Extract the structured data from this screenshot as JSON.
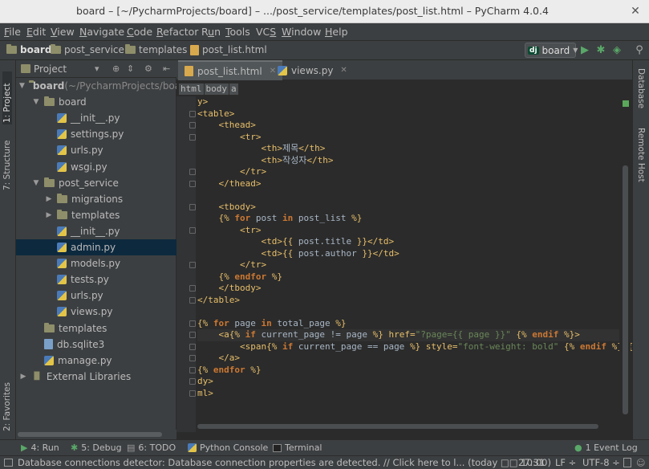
{
  "window": {
    "title": "board – [~/PycharmProjects/board] – .../post_service/templates/post_list.html – PyCharm 4.0.4"
  },
  "menu": [
    {
      "label": "File",
      "mnemonic": "F"
    },
    {
      "label": "Edit",
      "mnemonic": "E"
    },
    {
      "label": "View",
      "mnemonic": "V"
    },
    {
      "label": "Navigate",
      "mnemonic": "N"
    },
    {
      "label": "Code",
      "mnemonic": "C"
    },
    {
      "label": "Refactor",
      "mnemonic": "R"
    },
    {
      "label": "Run",
      "mnemonic": "u"
    },
    {
      "label": "Tools",
      "mnemonic": "T"
    },
    {
      "label": "VCS",
      "mnemonic": "S"
    },
    {
      "label": "Window",
      "mnemonic": "W"
    },
    {
      "label": "Help",
      "mnemonic": "H"
    }
  ],
  "navbar": {
    "crumbs": [
      "board",
      "post_service",
      "templates",
      "post_list.html"
    ],
    "run_config": {
      "badge": "dj",
      "label": "board"
    }
  },
  "left_stripe": {
    "project": "1: Project",
    "structure": "7: Structure",
    "favorites": "2: Favorites"
  },
  "right_stripe": {
    "database": "Database",
    "remote_host": "Remote Host"
  },
  "project_panel": {
    "title": "Project",
    "tree": [
      {
        "label": "board",
        "suffix": " (~/PycharmProjects/boar",
        "icon": "folder",
        "expanded": true
      },
      {
        "label": "board",
        "icon": "folder",
        "expanded": true
      },
      {
        "label": "__init__.py",
        "icon": "python-file"
      },
      {
        "label": "settings.py",
        "icon": "python-file"
      },
      {
        "label": "urls.py",
        "icon": "python-file"
      },
      {
        "label": "wsgi.py",
        "icon": "python-file"
      },
      {
        "label": "post_service",
        "icon": "folder",
        "expanded": true
      },
      {
        "label": "migrations",
        "icon": "folder",
        "expanded": false
      },
      {
        "label": "templates",
        "icon": "folder",
        "expanded": false
      },
      {
        "label": "__init__.py",
        "icon": "python-file"
      },
      {
        "label": "admin.py",
        "icon": "python-file",
        "selected": true
      },
      {
        "label": "models.py",
        "icon": "python-file"
      },
      {
        "label": "tests.py",
        "icon": "python-file"
      },
      {
        "label": "urls.py",
        "icon": "python-file"
      },
      {
        "label": "views.py",
        "icon": "python-file"
      },
      {
        "label": "templates",
        "icon": "folder"
      },
      {
        "label": "db.sqlite3",
        "icon": "database-file"
      },
      {
        "label": "manage.py",
        "icon": "python-file"
      },
      {
        "label": "External Libraries",
        "icon": "library",
        "expanded": false
      }
    ]
  },
  "editor": {
    "tabs": [
      {
        "label": "post_list.html",
        "icon": "html-file",
        "active": true
      },
      {
        "label": "views.py",
        "icon": "python-file",
        "active": false
      }
    ],
    "breadcrumbs": [
      "html",
      "body",
      "a"
    ],
    "lines": [
      [
        {
          "t": "tag",
          "s": "y>"
        }
      ],
      [
        {
          "t": "tag",
          "s": "<table>"
        }
      ],
      [
        {
          "t": "txt",
          "s": "    "
        },
        {
          "t": "tag",
          "s": "<thead>"
        }
      ],
      [
        {
          "t": "txt",
          "s": "        "
        },
        {
          "t": "tag",
          "s": "<tr>"
        }
      ],
      [
        {
          "t": "txt",
          "s": "            "
        },
        {
          "t": "tag",
          "s": "<th>"
        },
        {
          "t": "txt",
          "s": "제목"
        },
        {
          "t": "tag",
          "s": "</th>"
        }
      ],
      [
        {
          "t": "txt",
          "s": "            "
        },
        {
          "t": "tag",
          "s": "<th>"
        },
        {
          "t": "txt",
          "s": "작성자"
        },
        {
          "t": "tag",
          "s": "</th>"
        }
      ],
      [
        {
          "t": "txt",
          "s": "        "
        },
        {
          "t": "tag",
          "s": "</tr>"
        }
      ],
      [
        {
          "t": "txt",
          "s": "    "
        },
        {
          "t": "tag",
          "s": "</thead>"
        }
      ],
      [],
      [
        {
          "t": "txt",
          "s": "    "
        },
        {
          "t": "tag",
          "s": "<tbody>"
        }
      ],
      [
        {
          "t": "txt",
          "s": "    "
        },
        {
          "t": "tag",
          "s": "{% "
        },
        {
          "t": "kw",
          "s": "for"
        },
        {
          "t": "txt",
          "s": " post "
        },
        {
          "t": "kw",
          "s": "in"
        },
        {
          "t": "txt",
          "s": " post_list "
        },
        {
          "t": "tag",
          "s": "%}"
        }
      ],
      [
        {
          "t": "txt",
          "s": "        "
        },
        {
          "t": "tag",
          "s": "<tr>"
        }
      ],
      [
        {
          "t": "txt",
          "s": "            "
        },
        {
          "t": "tag",
          "s": "<td>"
        },
        {
          "t": "tag",
          "s": "{{"
        },
        {
          "t": "txt",
          "s": " post.title "
        },
        {
          "t": "tag",
          "s": "}}"
        },
        {
          "t": "tag",
          "s": "</td>"
        }
      ],
      [
        {
          "t": "txt",
          "s": "            "
        },
        {
          "t": "tag",
          "s": "<td>"
        },
        {
          "t": "tag",
          "s": "{{"
        },
        {
          "t": "txt",
          "s": " post.author "
        },
        {
          "t": "tag",
          "s": "}}"
        },
        {
          "t": "tag",
          "s": "</td>"
        }
      ],
      [
        {
          "t": "txt",
          "s": "        "
        },
        {
          "t": "tag",
          "s": "</tr>"
        }
      ],
      [
        {
          "t": "txt",
          "s": "    "
        },
        {
          "t": "tag",
          "s": "{% "
        },
        {
          "t": "kw",
          "s": "endfor"
        },
        {
          "t": "tag",
          "s": " %}"
        }
      ],
      [
        {
          "t": "txt",
          "s": "    "
        },
        {
          "t": "tag",
          "s": "</tbody>"
        }
      ],
      [
        {
          "t": "tag",
          "s": "</table>"
        }
      ],
      [],
      [
        {
          "t": "tag",
          "s": "{% "
        },
        {
          "t": "kw",
          "s": "for"
        },
        {
          "t": "txt",
          "s": " page "
        },
        {
          "t": "kw",
          "s": "in"
        },
        {
          "t": "txt",
          "s": " total_page "
        },
        {
          "t": "tag",
          "s": "%}"
        }
      ],
      [
        {
          "t": "txt",
          "s": "    "
        },
        {
          "t": "tag",
          "s": "<a"
        },
        {
          "t": "tag",
          "s": "{% "
        },
        {
          "t": "kw",
          "s": "if"
        },
        {
          "t": "txt",
          "s": " current_page != page "
        },
        {
          "t": "tag",
          "s": "%}"
        },
        {
          "t": "tag",
          "s": " href="
        },
        {
          "t": "str",
          "s": "\"?page={{ page }}\""
        },
        {
          "t": "tag",
          "s": " {% "
        },
        {
          "t": "kw",
          "s": "endif"
        },
        {
          "t": "tag",
          "s": " %}>"
        }
      ],
      [
        {
          "t": "txt",
          "s": "        "
        },
        {
          "t": "tag",
          "s": "<span"
        },
        {
          "t": "tag",
          "s": "{% "
        },
        {
          "t": "kw",
          "s": "if"
        },
        {
          "t": "txt",
          "s": " current_page == page "
        },
        {
          "t": "tag",
          "s": "%}"
        },
        {
          "t": "tag",
          "s": " style="
        },
        {
          "t": "str",
          "s": "\"font-weight: bold\""
        },
        {
          "t": "tag",
          "s": " {% "
        },
        {
          "t": "kw",
          "s": "endif"
        },
        {
          "t": "tag",
          "s": " %}>{"
        }
      ],
      [
        {
          "t": "txt",
          "s": "    "
        },
        {
          "t": "tag",
          "s": "</a>"
        }
      ],
      [
        {
          "t": "tag",
          "s": "{% "
        },
        {
          "t": "kw",
          "s": "endfor"
        },
        {
          "t": "tag",
          "s": " %}"
        }
      ],
      [
        {
          "t": "tag",
          "s": "dy>"
        }
      ],
      [
        {
          "t": "tag",
          "s": "ml>"
        }
      ]
    ],
    "highlight_line": 20
  },
  "bottom_tools": [
    {
      "label": "4: Run",
      "icon": "run-icon"
    },
    {
      "label": "5: Debug",
      "icon": "debug-icon"
    },
    {
      "label": "6: TODO",
      "icon": "todo-icon"
    },
    {
      "label": "Python Console",
      "icon": "python-console-icon"
    },
    {
      "label": "Terminal",
      "icon": "terminal-icon"
    },
    {
      "label": "1 Event Log",
      "icon": "event-log-icon"
    }
  ],
  "status": {
    "message": "Database connections detector: Database connection properties are detected. // Click here to l... (today □□ 10:00)",
    "position": "27:31",
    "line_sep": "LF ÷",
    "encoding": "UTF-8 ÷"
  },
  "colors": {
    "tag": "#e8bf6a",
    "keyword": "#cc7832",
    "string": "#6a8759",
    "text": "#a9b7c6",
    "selection": "#0d293e"
  }
}
